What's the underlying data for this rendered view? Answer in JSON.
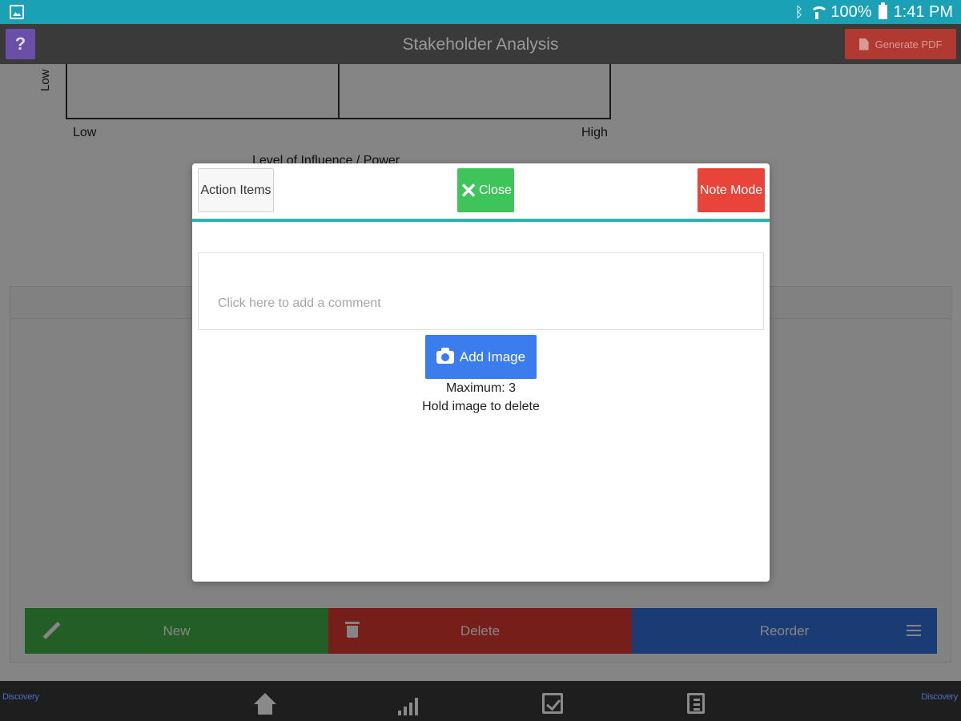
{
  "status_bar": {
    "battery": "100%",
    "time": "1:41 PM",
    "icons": [
      "gallery-icon",
      "bluetooth-icon",
      "wifi-icon",
      "battery-icon"
    ]
  },
  "app_bar": {
    "help_label": "?",
    "title": "Stakeholder Analysis",
    "generate_pdf": "Generate PDF"
  },
  "matrix": {
    "y_low": "Low",
    "x_low": "Low",
    "x_high": "High",
    "x_axis_title": "Level of Influence / Power"
  },
  "actions": {
    "new": "New",
    "delete": "Delete",
    "reorder": "Reorder"
  },
  "bottom_nav": {
    "brand": "Discovery",
    "items": [
      "home-icon",
      "chart-icon",
      "checklist-icon",
      "documents-icon"
    ]
  },
  "modal": {
    "action_items": "Action Items",
    "close": "Close",
    "note_mode": "Note Mode",
    "comment_placeholder": "Click here to add a comment",
    "add_image": "Add Image",
    "maximum": "Maximum: 3",
    "hold_hint": "Hold image to delete"
  },
  "colors": {
    "status_bar": "#1ba1b5",
    "accent_teal": "#2fb3ad",
    "close_green": "#3fc45c",
    "note_red": "#e8443a",
    "add_image_blue": "#3b7def"
  }
}
